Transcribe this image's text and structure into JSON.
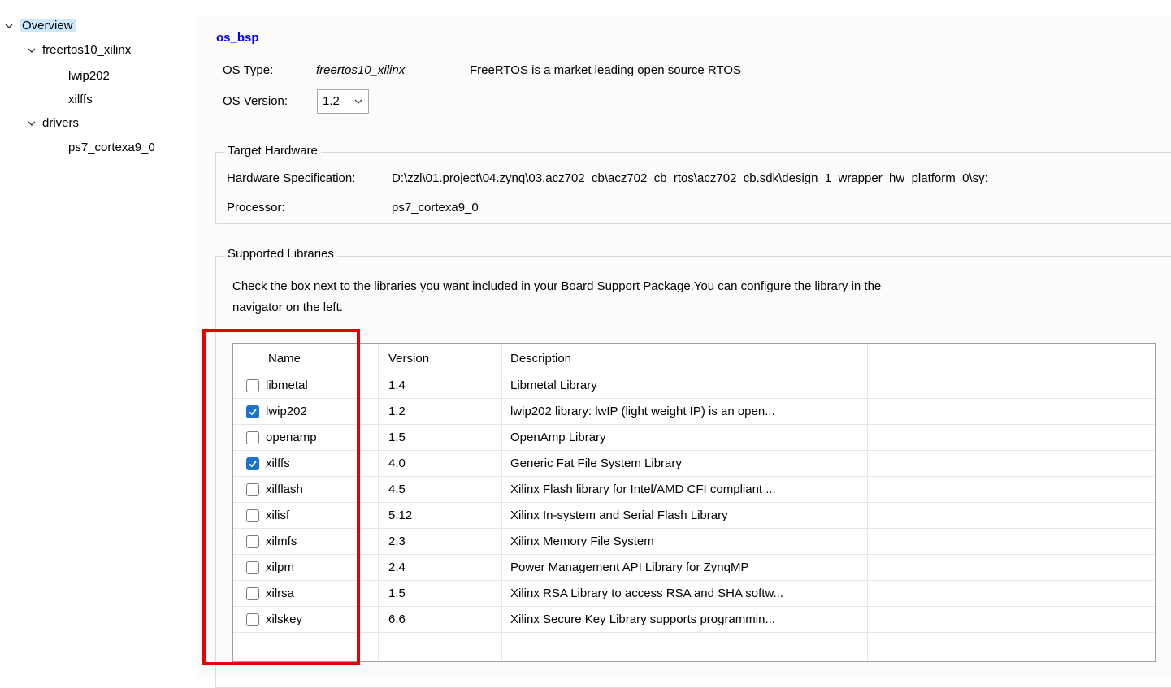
{
  "tree": {
    "items": [
      {
        "label": "Overview",
        "level": 0,
        "expanded": true,
        "selected": true
      },
      {
        "label": "freertos10_xilinx",
        "level": 1,
        "expanded": true
      },
      {
        "label": "lwip202",
        "level": 2
      },
      {
        "label": "xilffs",
        "level": 2
      },
      {
        "label": "drivers",
        "level": 1,
        "expanded": true
      },
      {
        "label": "ps7_cortexa9_0",
        "level": 2
      }
    ]
  },
  "main": {
    "title": "os_bsp",
    "os_type_label": "OS Type:",
    "os_type_value": "freertos10_xilinx",
    "os_type_description": "FreeRTOS is a market leading open source RTOS",
    "os_version_label": "OS Version:",
    "os_version_value": "1.2"
  },
  "target_hardware": {
    "legend": "Target Hardware",
    "hw_spec_label": "Hardware Specification:",
    "hw_spec_value": "D:\\zzl\\01.project\\04.zynq\\03.acz702_cb\\acz702_cb_rtos\\acz702_cb.sdk\\design_1_wrapper_hw_platform_0\\sy:",
    "processor_label": "Processor:",
    "processor_value": "ps7_cortexa9_0"
  },
  "libraries": {
    "legend": "Supported Libraries",
    "instructions_line1": "Check the box next to the libraries you want included in your Board Support Package.You can configure the library in the",
    "instructions_line2": "navigator on the left.",
    "columns": [
      "Name",
      "Version",
      "Description"
    ],
    "rows": [
      {
        "name": "libmetal",
        "version": "1.4",
        "description": "Libmetal Library",
        "checked": false
      },
      {
        "name": "lwip202",
        "version": "1.2",
        "description": "lwip202 library: lwIP (light weight IP) is an open...",
        "checked": true
      },
      {
        "name": "openamp",
        "version": "1.5",
        "description": "OpenAmp Library",
        "checked": false
      },
      {
        "name": "xilffs",
        "version": "4.0",
        "description": "Generic Fat File System Library",
        "checked": true
      },
      {
        "name": "xilflash",
        "version": "4.5",
        "description": "Xilinx Flash library for Intel/AMD CFI compliant ...",
        "checked": false
      },
      {
        "name": "xilisf",
        "version": "5.12",
        "description": "Xilinx In-system and Serial Flash Library",
        "checked": false
      },
      {
        "name": "xilmfs",
        "version": "2.3",
        "description": "Xilinx Memory File System",
        "checked": false
      },
      {
        "name": "xilpm",
        "version": "2.4",
        "description": "Power Management API Library for ZynqMP",
        "checked": false
      },
      {
        "name": "xilrsa",
        "version": "1.5",
        "description": "Xilinx RSA Library to access RSA and SHA softw...",
        "checked": false
      },
      {
        "name": "xilskey",
        "version": "6.6",
        "description": "Xilinx Secure Key Library supports programmin...",
        "checked": false
      }
    ]
  },
  "colors": {
    "accent": "#1a73c8",
    "highlight_box": "#e60000",
    "title_link": "#0000ee",
    "selection": "#cce8ff"
  }
}
